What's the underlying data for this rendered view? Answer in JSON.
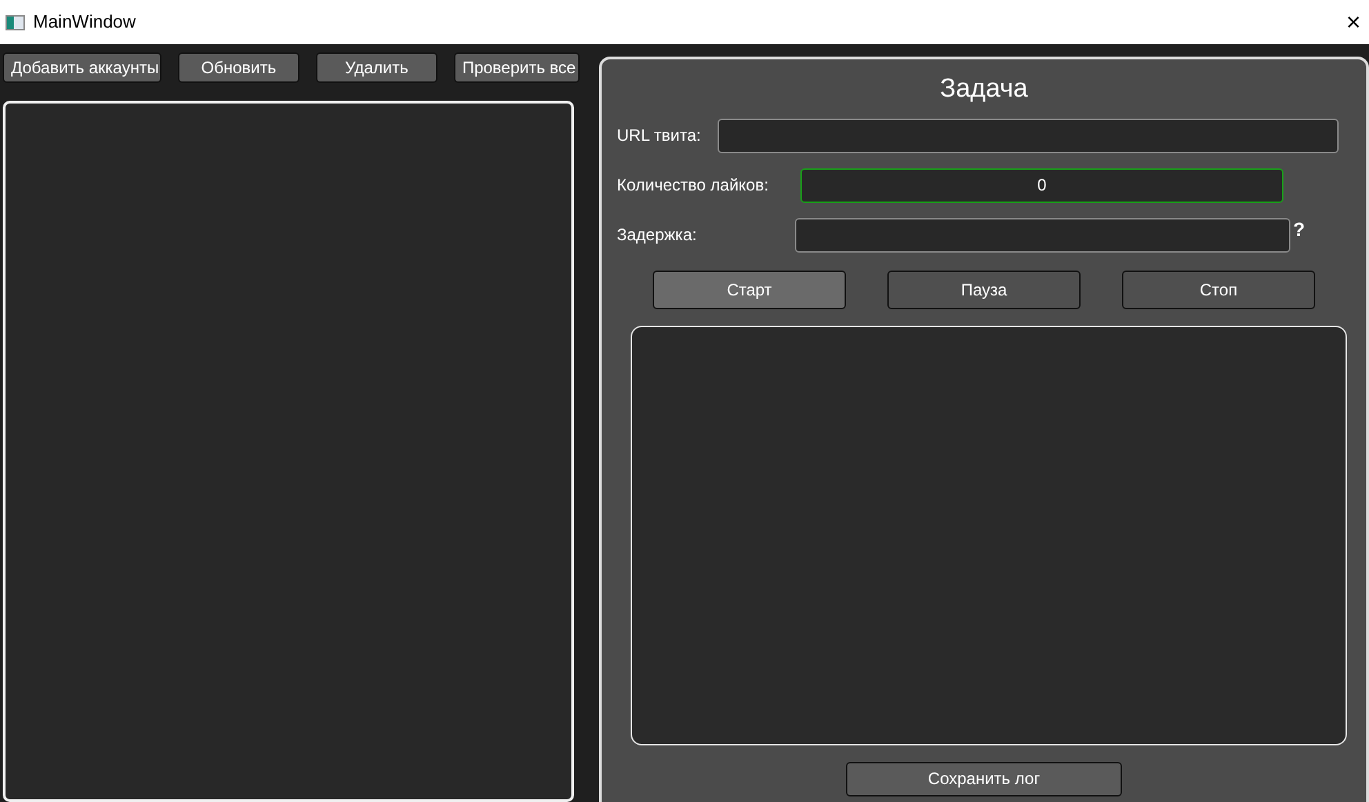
{
  "window": {
    "title": "MainWindow",
    "close": "×"
  },
  "toolbar": [
    "Добавить аккаунты",
    "Обновить",
    "Удалить",
    "Проверить все"
  ],
  "task": {
    "title": "Задача",
    "fields": [
      {
        "label": "URL твита:",
        "focused": false
      },
      {
        "label": "Количество лайков:",
        "value": "0",
        "focused": true
      },
      {
        "label": "Задержка:",
        "focused": false,
        "help": "?"
      }
    ],
    "buttons": [
      {
        "label": "Старт",
        "hovered": true
      },
      {
        "label": "Пауза",
        "hovered": false
      },
      {
        "label": "Стоп",
        "hovered": false
      }
    ],
    "save_button": "Сохранить лог"
  }
}
